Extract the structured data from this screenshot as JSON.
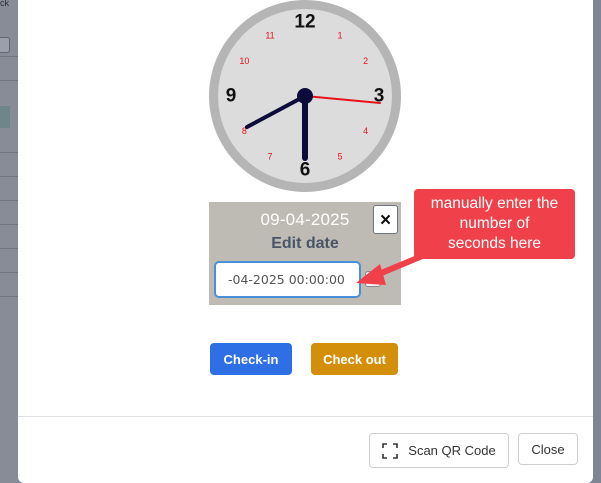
{
  "backdrop": {
    "fragment_text": "ck"
  },
  "clock": {
    "major_numbers": [
      "12",
      "3",
      "6",
      "9"
    ],
    "minor_numbers": [
      "1",
      "2",
      "4",
      "5",
      "7",
      "8",
      "10",
      "11"
    ],
    "time_shown": "8:30:15",
    "colors": {
      "face": "#dcdcdc",
      "rim": "#b5b5b5",
      "hands": "#0d0b3a",
      "second_hand": "#e8121b",
      "minor_numbers": "#e8121b"
    }
  },
  "date_panel": {
    "date_value": "09-04-2025",
    "close_label": "×",
    "edit_label": "Edit date",
    "input_value": "-04-2025 00:00:00"
  },
  "callout": {
    "lines": [
      "manually enter the",
      "number of",
      "seconds here"
    ],
    "color": "#f0404a"
  },
  "actions": {
    "checkin_label": "Check-in",
    "checkout_label": "Check out"
  },
  "footer": {
    "scan_label": "Scan QR Code",
    "close_label": "Close",
    "scan_icon": "scan-frame-icon"
  }
}
